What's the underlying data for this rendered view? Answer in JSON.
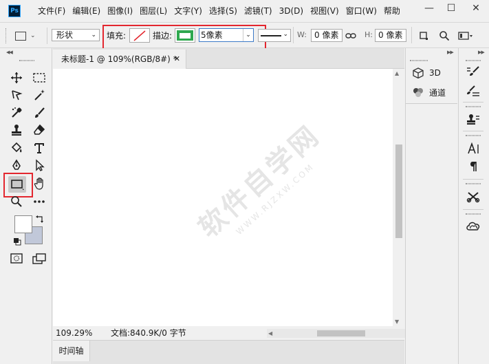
{
  "app": {
    "logo": "Ps"
  },
  "menu": {
    "items": [
      "文件(F)",
      "编辑(E)",
      "图像(I)",
      "图层(L)",
      "文字(Y)",
      "选择(S)",
      "滤镜(T)",
      "3D(D)",
      "视图(V)",
      "窗口(W)",
      "帮助"
    ]
  },
  "window_controls": {
    "minimize": "—",
    "maximize": "☐",
    "close": "✕"
  },
  "options": {
    "mode": "形状",
    "fill_label": "填充:",
    "stroke_label": "描边:",
    "stroke_width": "5像素",
    "w_label": "W:",
    "w_value": "0 像素",
    "h_label": "H:",
    "h_value": "0 像素",
    "colors": {
      "stroke_color": "#2fa84f",
      "fill_none_slash": "#e3262e",
      "highlight": "#e3262e"
    }
  },
  "document": {
    "tab_title": "未标题-1 @ 109%(RGB/8#) *",
    "close": "✕"
  },
  "status": {
    "zoom": "109.29%",
    "doc_info": "文档:840.9K/0 字节"
  },
  "timeline": {
    "label": "时间轴"
  },
  "right_panel": {
    "items": [
      {
        "label": "3D",
        "icon": "cube-icon"
      },
      {
        "label": "通道",
        "icon": "channels-icon"
      }
    ]
  },
  "watermark": {
    "main": "软件自学网",
    "sub": "WWW.RJZXW.COM"
  }
}
